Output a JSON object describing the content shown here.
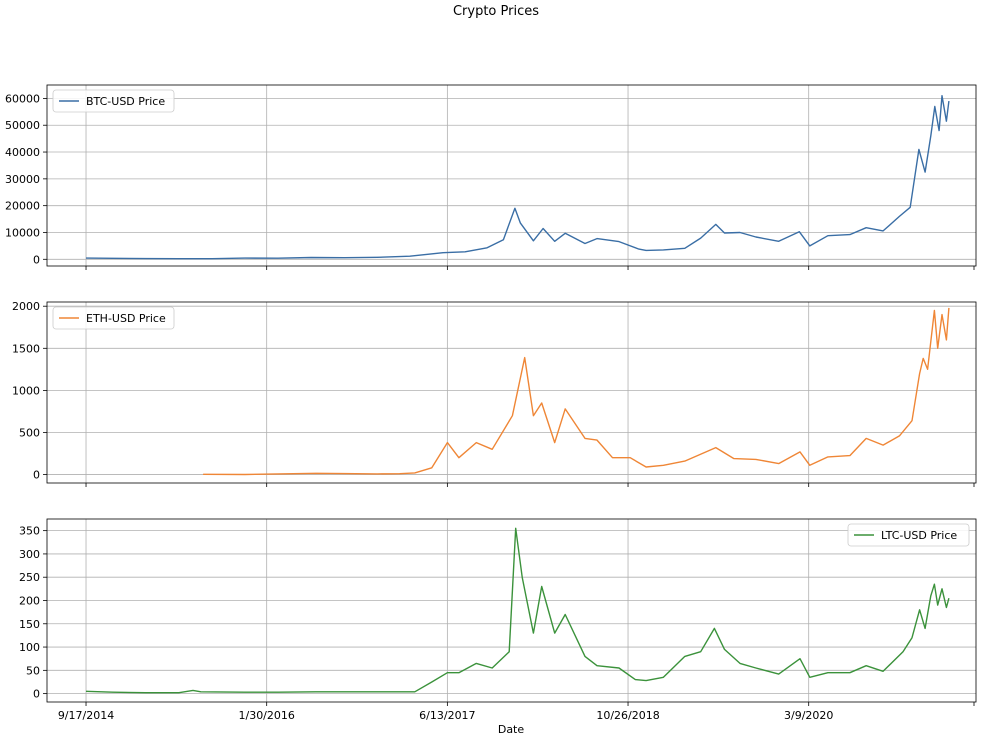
{
  "figure": {
    "title": "Crypto Prices",
    "xlabel": "Date"
  },
  "colors": {
    "btc": "#3a6ea5",
    "eth": "#ef8636",
    "ltc": "#3b923b"
  },
  "chart_data": [
    {
      "type": "line",
      "series": [
        {
          "name": "BTC-USD Price",
          "x": [
            "2014-09-17",
            "2014-12-01",
            "2015-03-01",
            "2015-06-01",
            "2015-09-01",
            "2015-12-01",
            "2016-03-01",
            "2016-06-01",
            "2016-09-01",
            "2016-12-01",
            "2017-03-01",
            "2017-06-01",
            "2017-08-01",
            "2017-10-01",
            "2017-11-15",
            "2017-12-17",
            "2018-01-01",
            "2018-02-06",
            "2018-03-05",
            "2018-04-06",
            "2018-05-05",
            "2018-06-29",
            "2018-08-01",
            "2018-10-01",
            "2018-11-25",
            "2018-12-15",
            "2019-02-01",
            "2019-04-01",
            "2019-05-15",
            "2019-06-26",
            "2019-07-20",
            "2019-09-01",
            "2019-10-15",
            "2019-12-17",
            "2020-02-12",
            "2020-03-12",
            "2020-05-01",
            "2020-07-01",
            "2020-08-15",
            "2020-10-01",
            "2020-11-15",
            "2020-12-15",
            "2021-01-08",
            "2021-01-25",
            "2021-02-10",
            "2021-02-21",
            "2021-03-05",
            "2021-03-13",
            "2021-03-25",
            "2021-04-01"
          ],
          "y": [
            460,
            370,
            250,
            230,
            230,
            430,
            420,
            670,
            600,
            750,
            1150,
            2450,
            2800,
            4300,
            7300,
            19000,
            13500,
            6900,
            11500,
            6700,
            9700,
            5900,
            7700,
            6600,
            3800,
            3300,
            3500,
            4100,
            7900,
            13000,
            9800,
            10000,
            8300,
            6700,
            10300,
            5000,
            8800,
            9200,
            11800,
            10600,
            16000,
            19400,
            41000,
            32500,
            46000,
            57000,
            48000,
            61000,
            51500,
            59000
          ]
        }
      ],
      "ylim": [
        -2500,
        65000
      ],
      "yticks": [
        0,
        10000,
        20000,
        30000,
        40000,
        50000,
        60000
      ],
      "legend": "upper left"
    },
    {
      "type": "line",
      "series": [
        {
          "name": "ETH-USD Price",
          "x": [
            "2015-08-07",
            "2015-12-01",
            "2016-03-01",
            "2016-06-15",
            "2016-09-01",
            "2016-12-01",
            "2017-02-01",
            "2017-03-15",
            "2017-05-01",
            "2017-06-13",
            "2017-07-15",
            "2017-09-01",
            "2017-10-15",
            "2017-12-10",
            "2018-01-13",
            "2018-02-06",
            "2018-03-01",
            "2018-04-06",
            "2018-05-05",
            "2018-06-29",
            "2018-08-01",
            "2018-09-13",
            "2018-11-01",
            "2018-12-15",
            "2019-02-01",
            "2019-04-01",
            "2019-06-26",
            "2019-08-15",
            "2019-10-15",
            "2019-12-17",
            "2020-02-14",
            "2020-03-12",
            "2020-05-01",
            "2020-07-01",
            "2020-08-15",
            "2020-10-01",
            "2020-11-15",
            "2020-12-20",
            "2021-01-10",
            "2021-01-20",
            "2021-02-01",
            "2021-02-20",
            "2021-03-01",
            "2021-03-13",
            "2021-03-25",
            "2021-04-01"
          ],
          "y": [
            3,
            1,
            8,
            15,
            12,
            8,
            11,
            20,
            80,
            380,
            200,
            380,
            300,
            700,
            1390,
            700,
            850,
            380,
            780,
            430,
            410,
            200,
            200,
            90,
            110,
            160,
            320,
            190,
            180,
            130,
            270,
            110,
            210,
            225,
            430,
            350,
            460,
            640,
            1200,
            1380,
            1250,
            1950,
            1500,
            1900,
            1600,
            1980
          ]
        }
      ],
      "ylim": [
        -100,
        2050
      ],
      "yticks": [
        0,
        500,
        1000,
        1500,
        2000
      ],
      "legend": "upper left"
    },
    {
      "type": "line",
      "series": [
        {
          "name": "LTC-USD Price",
          "x": [
            "2014-09-17",
            "2014-12-01",
            "2015-03-01",
            "2015-06-01",
            "2015-07-10",
            "2015-08-01",
            "2015-12-01",
            "2016-03-01",
            "2016-06-15",
            "2016-09-01",
            "2016-12-01",
            "2017-02-01",
            "2017-03-15",
            "2017-05-01",
            "2017-06-13",
            "2017-07-15",
            "2017-09-01",
            "2017-10-15",
            "2017-12-01",
            "2017-12-19",
            "2018-01-06",
            "2018-02-06",
            "2018-03-01",
            "2018-04-06",
            "2018-05-05",
            "2018-06-29",
            "2018-08-01",
            "2018-10-01",
            "2018-11-15",
            "2018-12-15",
            "2019-02-01",
            "2019-04-01",
            "2019-05-15",
            "2019-06-22",
            "2019-07-20",
            "2019-09-01",
            "2019-10-15",
            "2019-12-17",
            "2020-02-14",
            "2020-03-12",
            "2020-05-01",
            "2020-07-01",
            "2020-08-15",
            "2020-10-01",
            "2020-11-25",
            "2020-12-20",
            "2021-01-10",
            "2021-01-25",
            "2021-02-10",
            "2021-02-20",
            "2021-03-01",
            "2021-03-13",
            "2021-03-25",
            "2021-04-01"
          ],
          "y": [
            5,
            3,
            2,
            2,
            7,
            4,
            3,
            3,
            4,
            4,
            4,
            4,
            4,
            25,
            45,
            45,
            65,
            55,
            90,
            355,
            250,
            130,
            230,
            130,
            170,
            80,
            60,
            55,
            30,
            28,
            35,
            80,
            90,
            140,
            95,
            65,
            55,
            42,
            75,
            35,
            45,
            45,
            60,
            48,
            90,
            120,
            180,
            140,
            210,
            235,
            190,
            225,
            185,
            205
          ]
        }
      ],
      "ylim": [
        -18,
        375
      ],
      "yticks": [
        0,
        50,
        100,
        150,
        200,
        250,
        300,
        350
      ],
      "legend": "upper right"
    }
  ],
  "xaxis": {
    "range": [
      "2014-06-01",
      "2021-06-15"
    ],
    "ticks": [
      "2014-09-17",
      "2016-01-30",
      "2017-06-13",
      "2018-10-26",
      "2020-03-09"
    ],
    "tick_labels": [
      "9/17/2014",
      "1/30/2016",
      "6/13/2017",
      "10/26/2018",
      "3/9/2020"
    ]
  }
}
